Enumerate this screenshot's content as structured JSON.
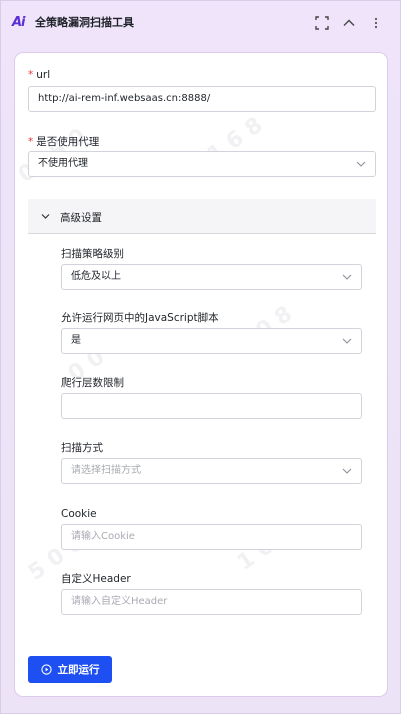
{
  "app": {
    "logo_text": "Ai",
    "title": "全策略漏洞扫描工具"
  },
  "form": {
    "url": {
      "label": "url",
      "value": "http://ai-rem-inf.websaas.cn:8888/"
    },
    "proxy": {
      "label": "是否使用代理",
      "value": "不使用代理"
    },
    "advanced": {
      "title": "高级设置",
      "strategy_level": {
        "label": "扫描策略级别",
        "value": "低危及以上"
      },
      "allow_js": {
        "label": "允许运行网页中的JavaScript脚本",
        "value": "是"
      },
      "crawl_depth": {
        "label": "爬行层数限制",
        "value": ""
      },
      "scan_mode": {
        "label": "扫描方式",
        "placeholder": "请选择扫描方式"
      },
      "cookie": {
        "label": "Cookie",
        "placeholder": "请输入Cookie"
      },
      "header": {
        "label": "自定义Header",
        "placeholder": "请输入自定义Header"
      }
    },
    "run_button": "立即运行"
  },
  "colors": {
    "accent": "#1d4ff2",
    "required": "#e23a3a",
    "logo": "#5a2dd6"
  }
}
